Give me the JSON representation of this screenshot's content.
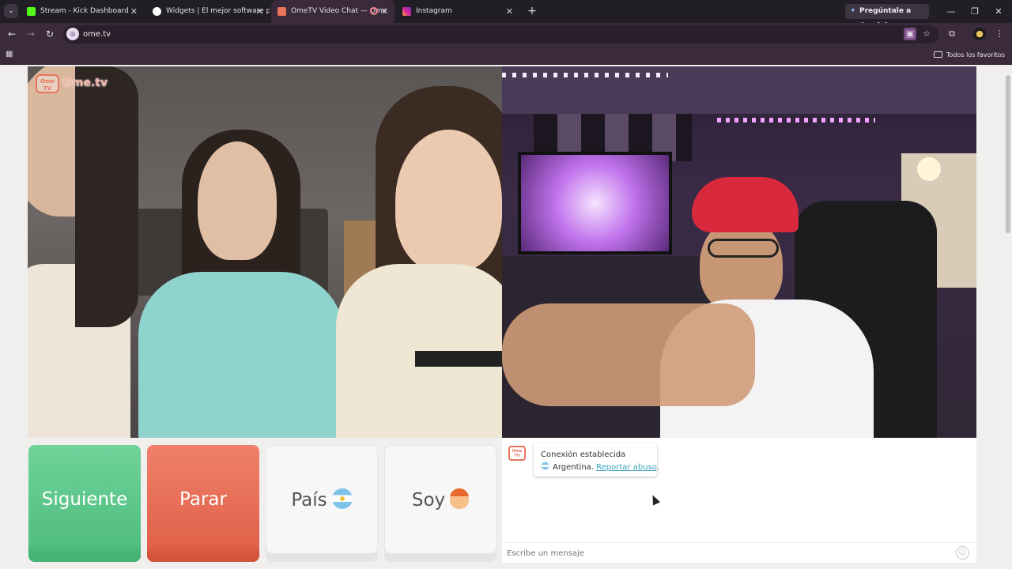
{
  "browser": {
    "tabs": [
      {
        "title": "Stream - Kick Dashboard",
        "icon": "kick-icon",
        "color": "#53fc18"
      },
      {
        "title": "Widgets | El mejor software par",
        "icon": "widgets-icon",
        "color": "#ffffff"
      },
      {
        "title": "OmeTV Video Chat — Ome",
        "icon": "ometv-icon",
        "color": "#e8745c",
        "active": true
      },
      {
        "title": "Instagram",
        "icon": "instagram-icon",
        "color": "#d6249f"
      }
    ],
    "gemini_label": "Pregúntale a Gemini",
    "url": "ome.tv",
    "bookmarks_all": "Todos los favoritos"
  },
  "page": {
    "logo_tv": "Ome TV",
    "logo_brand": "Ome.tv",
    "buttons": {
      "next": "Siguiente",
      "stop": "Parar",
      "country": "País",
      "soy": "Soy"
    },
    "chat": {
      "logo": "Ome TV",
      "status": "Conexión establecida",
      "country": "Argentina.",
      "report": "Reportar abuso",
      "report_suffix": ".",
      "placeholder": "Escribe un mensaje"
    }
  },
  "colors": {
    "next_green": "#52be80",
    "stop_red": "#e1624a",
    "brand_orange": "#e8745c"
  }
}
